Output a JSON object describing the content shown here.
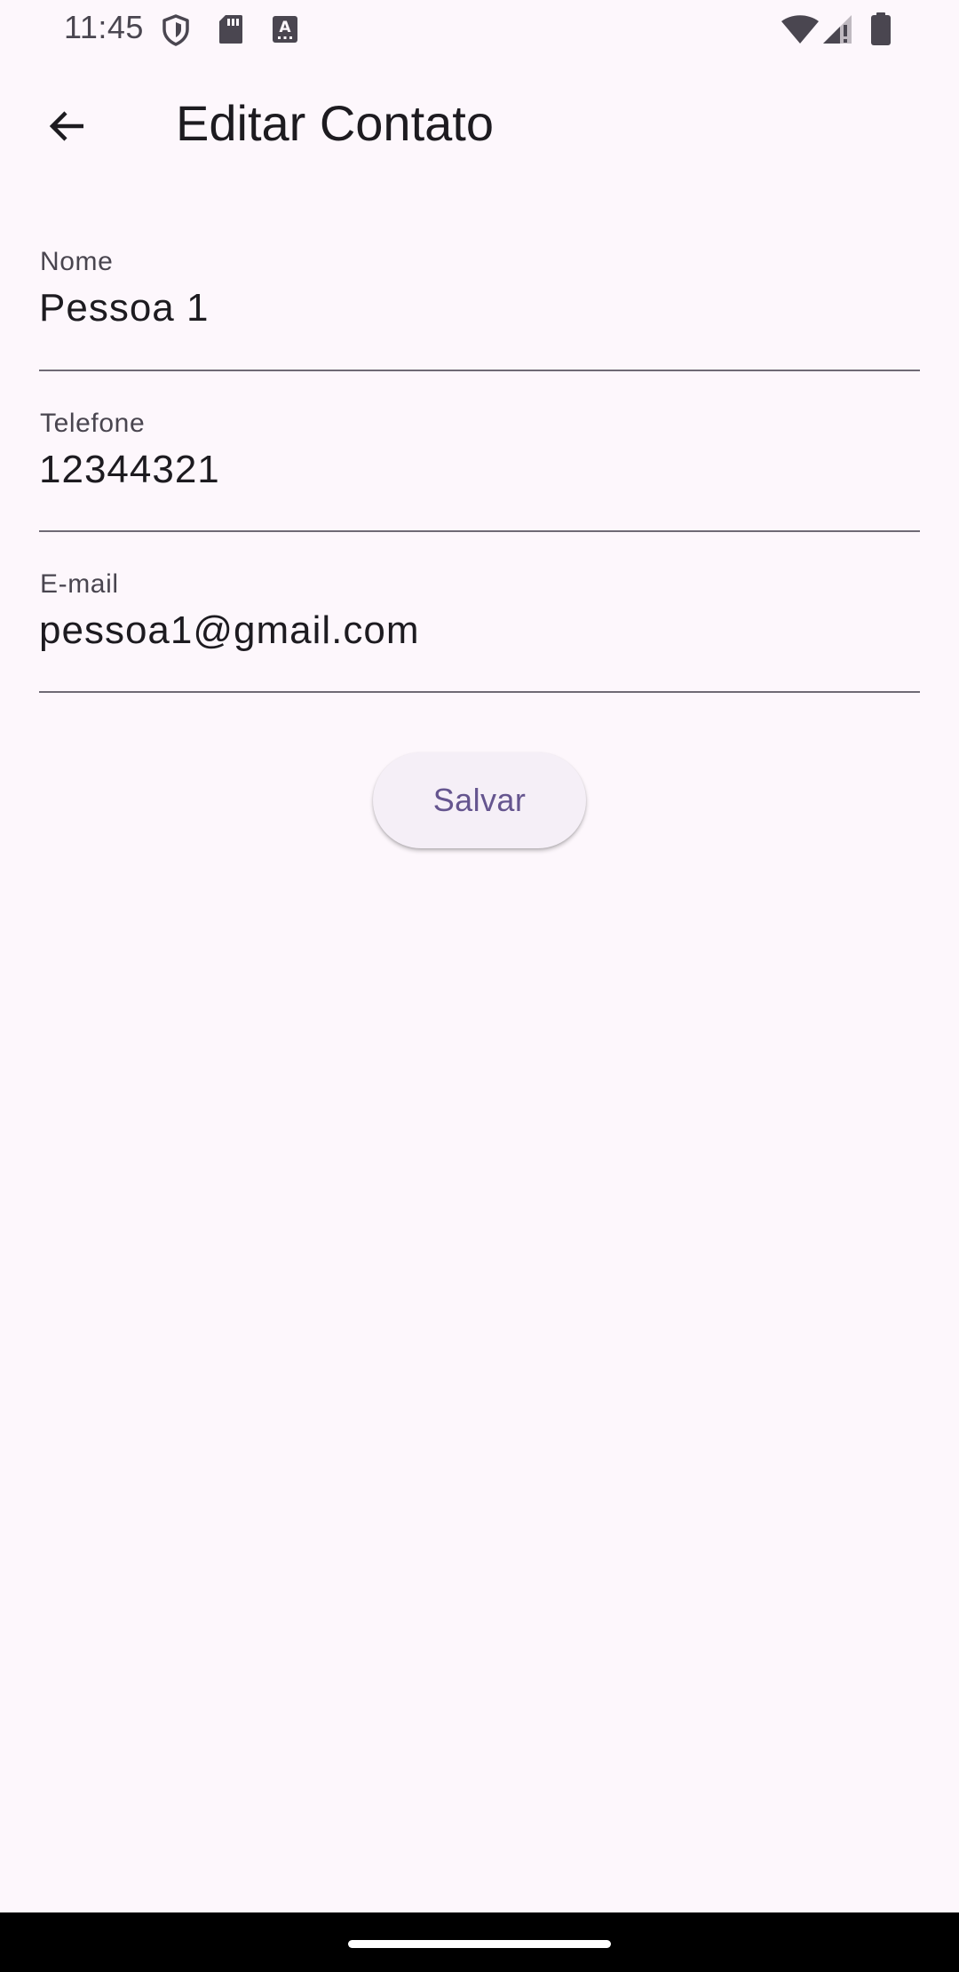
{
  "status_bar": {
    "time": "11:45",
    "icons_left": [
      "shield-icon",
      "sd-card-icon",
      "keyboard-a-icon"
    ],
    "icons_right": [
      "wifi-icon",
      "signal-icon",
      "battery-icon"
    ]
  },
  "app_bar": {
    "title": "Editar Contato",
    "back_icon": "arrow-back-icon"
  },
  "form": {
    "nome": {
      "label": "Nome",
      "value": "Pessoa 1"
    },
    "telefone": {
      "label": "Telefone",
      "value": "12344321"
    },
    "email": {
      "label": "E-mail",
      "value": "pessoa1@gmail.com"
    }
  },
  "save_button": {
    "label": "Salvar"
  },
  "colors": {
    "background": "#fdf7fc",
    "accent": "#65558f",
    "button_bg": "#f5eff7",
    "underline": "#6f6a75",
    "text": "#1d1b20"
  }
}
